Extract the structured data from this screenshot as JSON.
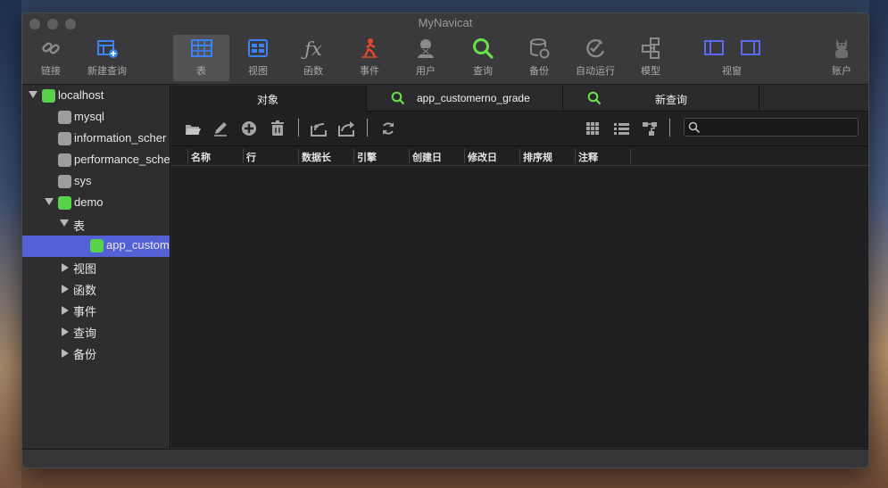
{
  "app": {
    "title": "MyNavicat"
  },
  "toolbar": {
    "buttons": [
      {
        "label": "链接",
        "icon": "link-icon"
      },
      {
        "label": "新建查询",
        "icon": "new-query-icon"
      },
      {
        "label": "表",
        "icon": "table-icon"
      },
      {
        "label": "视图",
        "icon": "view-icon"
      },
      {
        "label": "函数",
        "icon": "function-icon"
      },
      {
        "label": "事件",
        "icon": "event-icon"
      },
      {
        "label": "用户",
        "icon": "user-icon"
      },
      {
        "label": "查询",
        "icon": "query-icon"
      },
      {
        "label": "备份",
        "icon": "backup-icon"
      },
      {
        "label": "自动运行",
        "icon": "autorun-icon"
      },
      {
        "label": "模型",
        "icon": "model-icon"
      },
      {
        "label": "视窗",
        "icon": "window-icon"
      },
      {
        "label": "账户",
        "icon": "account-icon"
      }
    ]
  },
  "sidebar": {
    "connection": "localhost",
    "databases": [
      "mysql",
      "information_scher",
      "performance_sche",
      "sys",
      "demo"
    ],
    "demo_children": {
      "tables_group": "表",
      "selected_table": "app_custom"
    },
    "groups": [
      "视图",
      "函数",
      "事件",
      "查询",
      "备份"
    ]
  },
  "tabs": [
    {
      "label": "对象"
    },
    {
      "label": "app_customerno_grade"
    },
    {
      "label": "新查询"
    }
  ],
  "object_toolbar": {
    "icons": [
      "open-table-icon",
      "design-table-icon",
      "new-table-icon",
      "delete-table-icon",
      "import-icon",
      "export-icon",
      "refresh-icon",
      "grid-view-icon",
      "list-view-icon",
      "er-diagram-icon"
    ],
    "search": {
      "placeholder": ""
    }
  },
  "columns": [
    "名称",
    "行",
    "数据长",
    "引擎",
    "创建日",
    "修改日",
    "排序规",
    "注释"
  ],
  "colors": {
    "accent": "#5461d4",
    "green": "#57d24a",
    "blue_icon": "#3b82f6"
  }
}
